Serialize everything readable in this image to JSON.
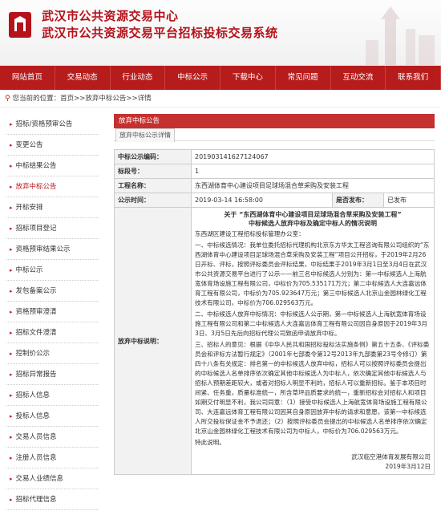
{
  "header": {
    "title_line1": "武汉市公共资源交易中心",
    "title_line2": "武汉市公共资源交易平台招标投标交易系统"
  },
  "nav": [
    "网站首页",
    "交易动态",
    "行业动态",
    "中标公示",
    "下载中心",
    "常见问题",
    "互动交流",
    "联系我们"
  ],
  "breadcrumb": "您当前的位置：首页>>放弃中标公告>>详情",
  "sidebar": {
    "items": [
      {
        "label": "招标/资格预审公告"
      },
      {
        "label": "变更公告"
      },
      {
        "label": "中标结果公告"
      },
      {
        "label": "放弃中标公告"
      },
      {
        "label": "开标安排"
      },
      {
        "label": "招标项目登记"
      },
      {
        "label": "资格预审结果公示"
      },
      {
        "label": "中标公示"
      },
      {
        "label": "发包备案公示"
      },
      {
        "label": "资格预审澄清"
      },
      {
        "label": "招标文件澄清"
      },
      {
        "label": "控制价公示"
      },
      {
        "label": "招标异常报告"
      },
      {
        "label": "招标人信息"
      },
      {
        "label": "投标人信息"
      },
      {
        "label": "交易人员信息"
      },
      {
        "label": "注册人员信息"
      },
      {
        "label": "交易人业绩信息"
      },
      {
        "label": "招标代理信息"
      }
    ]
  },
  "panel": {
    "title": "放弃中标公告",
    "subtab": "放弃中标公示详情"
  },
  "detail": {
    "code_label": "中标公示编码：",
    "code_value": "201903141627124067",
    "section_label": "标段号：",
    "section_value": "1",
    "project_label": "工程名称：",
    "project_value": "东西湖体育中心建设项目足球场混合草采购及安装工程",
    "time_label": "公示时间：",
    "time_value": "2019-03-14 16:58:00",
    "status_label": "是否发布：",
    "status_value": "已发布",
    "desc_label": "放弃中标说明："
  },
  "announcement": {
    "title1": "关于 “东西湖体育中心建设项目足球场混合草采购及安装工程”",
    "title2": "中标候选人放弃中标及确定中标人的情况说明",
    "addressee": "东西湖区建设工程招标投标管理办公室：",
    "p1": "一、中标候选情况：我单位委托招标代理机构北京东方华太工程咨询有限公司组织的“东西湖体育中心建设项目足球场混合草采购及安装工程”项目公开招标，于2019年2月26日开标、评标，按照评标委员会评标结果，中标结果于2019年3月1日至3月4日在武汉市公共资源交易平台进行了公示——前三名中标候选人分别为：第一中标候选人上海航宽体育场设施工程有限公司，中标价为705.535171万元；第二中标候选人大连嘉远体育工程有限公司，中标价为705.923647万元；第三中标候选人北京山金园林绿化工程技术有限公司，中标价为706.029563万元。",
    "p2": "二、中标候选人放弃中标情况：中标候选人公示期，第一中标候选人上海航宽体育场设施工程有限公司和第二中标候选人大连嘉远体育工程有限公司因自身原因于2019年3月3日、3月5日先后向招标代理公司致函申请放弃中标。",
    "p3": "三、招标人的意见：根据《中华人民共和国招标投标法实施条例》第五十五条、《评标委员会和评标方法暂行规定》（2001年七部委令第12号2013年九部委第23号令修订）第四十八条有关规定：排名第一的中标候选人放弃中标，招标人可以按照评标委员会提出的中标候选人名单排序依次确定其他中标候选人为中标人，依次确定其他中标候选人与招标人预期差距较大，或者对招标人明显不利的，招标人可以重新招标。鉴于本项目时间紧、任务重，质量标准统一，所含草坪品质要求的统一，重新招标会对招标人和项目如期交付明显不利，我公司同意：（1）接受中标候选人上海航宽体育场设施工程有限公司、大连嘉远体育工程有限公司因其自身原因放弃中标的请求和意愿，该第一中标候选人所交投标保证金不予退还；（2）按照评标委员会提出的中标候选人名单排序依次确定北京山金园林绿化工程技术有限公司为中标人，中标价为706.029563万元。",
    "p4": "特此说明。",
    "sign1": "武汉临空港体育发展有限公司",
    "sign2": "2019年3月12日"
  }
}
